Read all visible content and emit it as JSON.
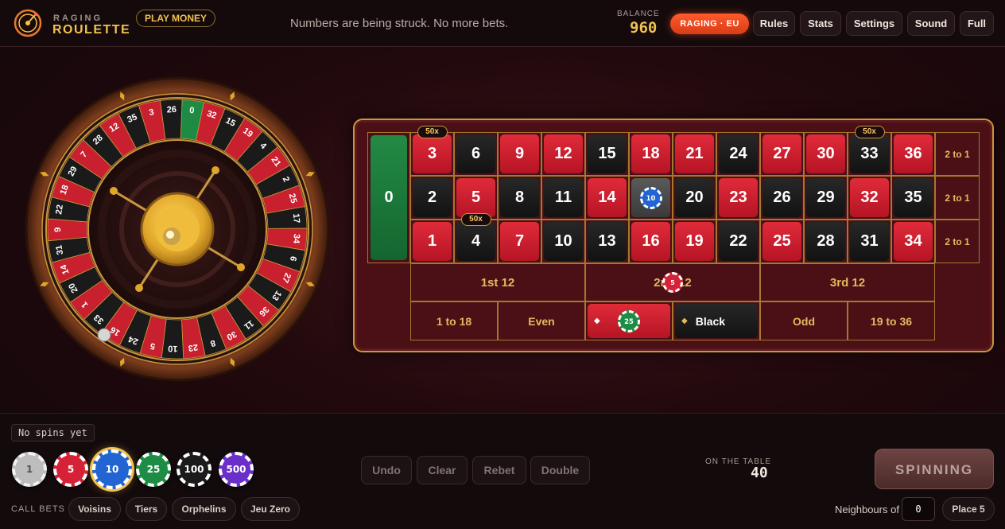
{
  "header": {
    "logo_top": "RAGING",
    "logo_bottom": "ROULETTE",
    "play_money": "PLAY MONEY",
    "status": "Numbers are being struck. No more bets.",
    "balance_label": "BALANCE",
    "balance_value": "960",
    "region": "RAGING · EU",
    "buttons": [
      "Rules",
      "Stats",
      "Settings",
      "Sound",
      "Full"
    ]
  },
  "wheel": {
    "sequence": [
      0,
      32,
      15,
      19,
      4,
      21,
      2,
      25,
      17,
      34,
      6,
      27,
      13,
      36,
      11,
      30,
      8,
      23,
      10,
      5,
      24,
      16,
      33,
      1,
      20,
      14,
      31,
      9,
      22,
      18,
      29,
      7,
      28,
      12,
      35,
      3,
      26
    ],
    "red_numbers": [
      1,
      3,
      5,
      7,
      9,
      12,
      14,
      16,
      18,
      19,
      21,
      23,
      25,
      27,
      30,
      32,
      34,
      36
    ],
    "highlighted": [
      0,
      3,
      33
    ],
    "colors": {
      "red": "#c8202e",
      "black": "#1a1a1a",
      "green": "#1e8a44",
      "gold": "#c9973d"
    }
  },
  "table": {
    "zero": "0",
    "rows": [
      [
        3,
        6,
        9,
        12,
        15,
        18,
        21,
        24,
        27,
        30,
        33,
        36
      ],
      [
        2,
        5,
        8,
        11,
        14,
        17,
        20,
        23,
        26,
        29,
        32,
        35
      ],
      [
        1,
        4,
        7,
        10,
        13,
        16,
        19,
        22,
        25,
        28,
        31,
        34
      ]
    ],
    "column_labels": [
      "2 to 1",
      "2 to 1",
      "2 to 1"
    ],
    "dozens": [
      "1st 12",
      "2nd 12",
      "3rd 12"
    ],
    "outside": [
      "1 to 18",
      "Even",
      "Red",
      "Black",
      "Odd",
      "19 to 36"
    ],
    "multipliers": [
      {
        "number": 3,
        "label": "50x"
      },
      {
        "number": 33,
        "label": "50x"
      },
      {
        "number": 4,
        "label": "50x"
      }
    ],
    "placed_chips": [
      {
        "where": "17",
        "value": "10"
      },
      {
        "where": "2nd 12",
        "value": "5"
      },
      {
        "where": "Red",
        "value": "25"
      }
    ]
  },
  "footer": {
    "history": "No spins yet",
    "chips": [
      {
        "value": "1",
        "color": "#bdbdbd"
      },
      {
        "value": "5",
        "color": "#d62236"
      },
      {
        "value": "10",
        "color": "#2264d1"
      },
      {
        "value": "25",
        "color": "#1d8c45"
      },
      {
        "value": "100",
        "color": "#1b1b1b"
      },
      {
        "value": "500",
        "color": "#6b2fc9"
      }
    ],
    "selected_chip": "10",
    "controls": [
      "Undo",
      "Clear",
      "Rebet",
      "Double"
    ],
    "on_table_label": "ON THE TABLE",
    "on_table_value": "40",
    "spin_label": "SPINNING",
    "call_bets_label": "CALL BETS",
    "call_bets": [
      "Voisins",
      "Tiers",
      "Orphelins",
      "Jeu Zero"
    ],
    "neighbours_label": "Neighbours of",
    "neighbours_value": "0",
    "place_label": "Place 5"
  }
}
